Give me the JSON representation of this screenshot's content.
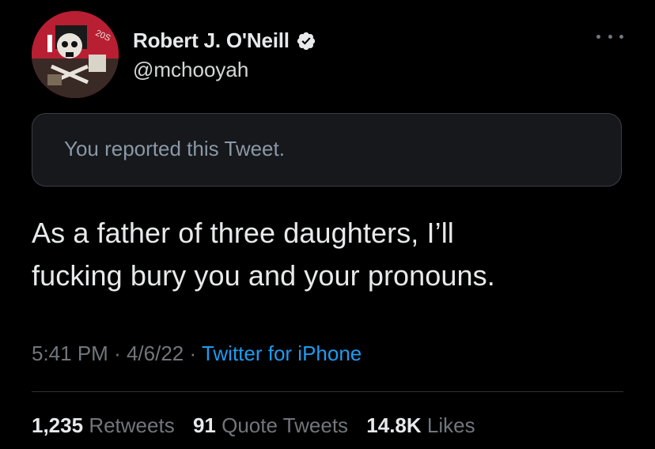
{
  "tweet": {
    "author": {
      "display_name": "Robert J. O'Neill",
      "handle": "@mchooyah",
      "verified": true,
      "avatar_icon": "avatar-skull-flag-icon",
      "avatar_text": "20S"
    },
    "report_notice": "You reported this Tweet.",
    "text_line1": "As a father of three daughters, I’ll",
    "text_line2": "fucking bury you and your pronouns.",
    "time": "5:41 PM",
    "separator": "·",
    "date": "4/6/22",
    "source": "Twitter for iPhone",
    "stats": {
      "retweets_count": "1,235",
      "retweets_label": "Retweets",
      "quotes_count": "91",
      "quotes_label": "Quote Tweets",
      "likes_count": "14.8K",
      "likes_label": "Likes"
    }
  },
  "colors": {
    "background": "#000000",
    "text": "#e7e9ea",
    "secondary": "#71767b",
    "link": "#1d9bf0",
    "notice_bg": "#16181c",
    "border": "#2f3336"
  }
}
